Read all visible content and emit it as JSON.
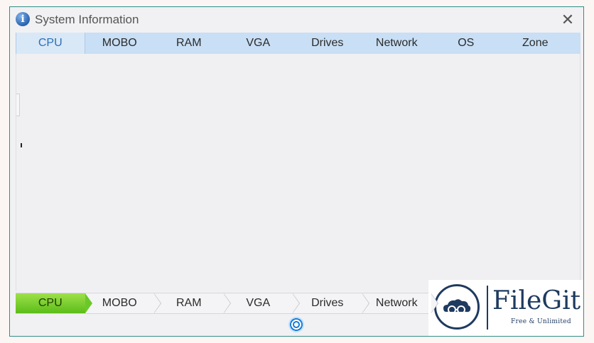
{
  "window": {
    "title": "System Information",
    "title_icon": "info-icon",
    "close_glyph": "✕"
  },
  "top_tabs": [
    {
      "label": "CPU",
      "active": true
    },
    {
      "label": "MOBO",
      "active": false
    },
    {
      "label": "RAM",
      "active": false
    },
    {
      "label": "VGA",
      "active": false
    },
    {
      "label": "Drives",
      "active": false
    },
    {
      "label": "Network",
      "active": false
    },
    {
      "label": "OS",
      "active": false
    },
    {
      "label": "Zone",
      "active": false
    }
  ],
  "step_bar": [
    {
      "label": "CPU",
      "active": true
    },
    {
      "label": "MOBO",
      "active": false
    },
    {
      "label": "RAM",
      "active": false
    },
    {
      "label": "VGA",
      "active": false
    },
    {
      "label": "Drives",
      "active": false
    },
    {
      "label": "Network",
      "active": false
    }
  ],
  "footer": {
    "spinner_icon": "refresh-spinner-icon"
  },
  "watermark": {
    "name": "FileGit",
    "tagline": "Free & Unlimited"
  },
  "colors": {
    "tab_bar": "#c8dff5",
    "active_step": "#6cc82a",
    "window_border": "#2f8f86",
    "brand": "#1e3a5f"
  }
}
